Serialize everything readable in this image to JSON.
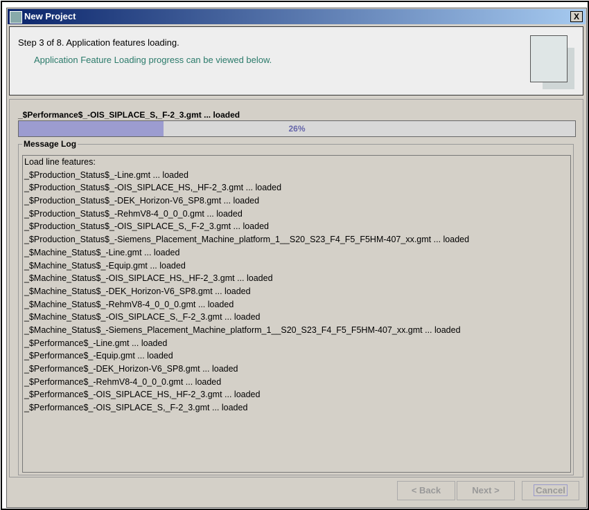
{
  "window": {
    "title": "New Project",
    "close": "X"
  },
  "header": {
    "step": "Step 3 of 8. Application features loading.",
    "subtitle": "Application Feature Loading progress can be viewed below."
  },
  "progress": {
    "status": "_$Performance$_-OIS_SIPLACE_S,_F-2_3.gmt ... loaded",
    "percent": 26,
    "percent_label": "26%",
    "color": "#9c9cd0"
  },
  "log": {
    "title": "Message Log",
    "lines": [
      "Load line features:",
      "_$Production_Status$_-Line.gmt ... loaded",
      "_$Production_Status$_-OIS_SIPLACE_HS,_HF-2_3.gmt ... loaded",
      "_$Production_Status$_-DEK_Horizon-V6_SP8.gmt ... loaded",
      "_$Production_Status$_-RehmV8-4_0_0_0.gmt ... loaded",
      "_$Production_Status$_-OIS_SIPLACE_S,_F-2_3.gmt ... loaded",
      "_$Production_Status$_-Siemens_Placement_Machine_platform_1__S20_S23_F4_F5_F5HM-407_xx.gmt ... loaded",
      "_$Machine_Status$_-Line.gmt ... loaded",
      "_$Machine_Status$_-Equip.gmt ... loaded",
      "_$Machine_Status$_-OIS_SIPLACE_HS,_HF-2_3.gmt ... loaded",
      "_$Machine_Status$_-DEK_Horizon-V6_SP8.gmt ... loaded",
      "_$Machine_Status$_-RehmV8-4_0_0_0.gmt ... loaded",
      "_$Machine_Status$_-OIS_SIPLACE_S,_F-2_3.gmt ... loaded",
      "_$Machine_Status$_-Siemens_Placement_Machine_platform_1__S20_S23_F4_F5_F5HM-407_xx.gmt ... loaded",
      "_$Performance$_-Line.gmt ... loaded",
      "_$Performance$_-Equip.gmt ... loaded",
      "_$Performance$_-DEK_Horizon-V6_SP8.gmt ... loaded",
      "_$Performance$_-RehmV8-4_0_0_0.gmt ... loaded",
      "_$Performance$_-OIS_SIPLACE_HS,_HF-2_3.gmt ... loaded",
      "_$Performance$_-OIS_SIPLACE_S,_F-2_3.gmt ... loaded"
    ]
  },
  "buttons": {
    "back": "< Back",
    "next": "Next >",
    "cancel": "Cancel"
  }
}
